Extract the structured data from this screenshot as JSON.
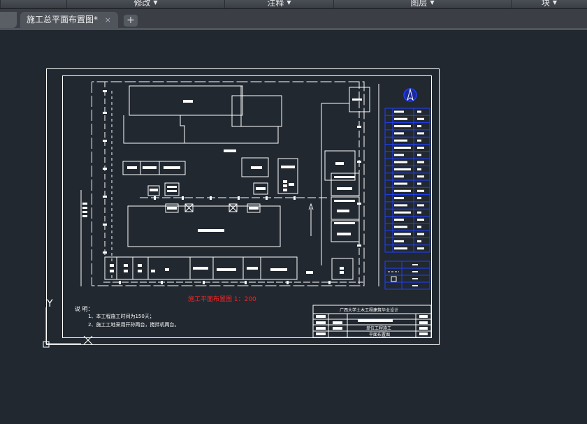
{
  "menubar": {
    "items": [
      {
        "label": "修改"
      },
      {
        "label": "注释"
      },
      {
        "label": "图层"
      },
      {
        "label": "块"
      }
    ]
  },
  "tabs": {
    "active_label": "施工总平面布置图*",
    "close_glyph": "×",
    "add_glyph": "+"
  },
  "drawing": {
    "plan_title": "施工平面布置图 1：200",
    "notes_heading": "说  明：",
    "notes": [
      "1、本工程施工时间为150天；",
      "2、施工工地采用开孙两台，搅拌机两台。"
    ],
    "title_block": {
      "header": "广西大学土木工程建筑毕业设计",
      "drawing_name_line1": "单位工程施工",
      "drawing_name_line2": "平面布置图"
    },
    "ucs": {
      "y_label": "Y"
    }
  },
  "colors": {
    "canvas_bg": "#212830",
    "line": "#ffffff",
    "legend": "#1f3fff",
    "title_text": "#ff2020"
  }
}
